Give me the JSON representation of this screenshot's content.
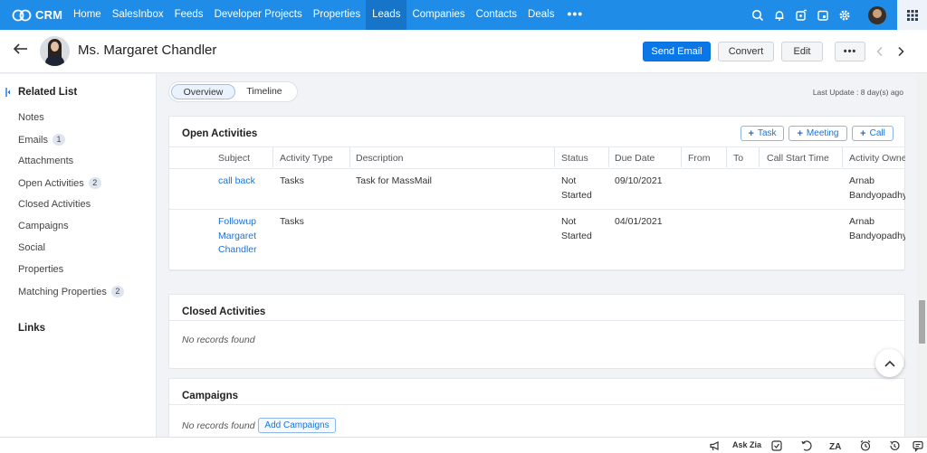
{
  "app": {
    "name": "CRM"
  },
  "nav": {
    "items": [
      "Home",
      "SalesInbox",
      "Feeds",
      "Developer Projects",
      "Properties",
      "Leads",
      "Companies",
      "Contacts",
      "Deals"
    ],
    "active": "Leads",
    "more": "•••",
    "icons": [
      "search-icon",
      "bell-icon",
      "compose-icon",
      "calendar-icon",
      "gear-icon",
      "user-avatar",
      "apps-grid-icon"
    ]
  },
  "record": {
    "name": "Ms. Margaret Chandler",
    "buttons": {
      "send_email": "Send Email",
      "convert": "Convert",
      "edit": "Edit",
      "more": "•••"
    }
  },
  "sidebar": {
    "title": "Related List",
    "items": [
      {
        "label": "Notes",
        "count": ""
      },
      {
        "label": "Emails",
        "count": "1"
      },
      {
        "label": "Attachments",
        "count": ""
      },
      {
        "label": "Open Activities",
        "count": "2"
      },
      {
        "label": "Closed Activities",
        "count": ""
      },
      {
        "label": "Campaigns",
        "count": ""
      },
      {
        "label": "Social",
        "count": ""
      },
      {
        "label": "Properties",
        "count": ""
      },
      {
        "label": "Matching Properties",
        "count": "2"
      }
    ],
    "links": "Links"
  },
  "tabs": {
    "overview": "Overview",
    "timeline": "Timeline"
  },
  "last_update": "Last Update : 8 day(s) ago",
  "open_activities": {
    "title": "Open Activities",
    "buttons": {
      "task": "Task",
      "meeting": "Meeting",
      "call": "Call"
    },
    "columns": [
      "Subject",
      "Activity Type",
      "Description",
      "Status",
      "Due Date",
      "From",
      "To",
      "Call Start Time",
      "Activity Owne"
    ],
    "rows": [
      {
        "subject": [
          "call back"
        ],
        "type": "Tasks",
        "description": "Task for MassMail",
        "status": [
          "Not",
          "Started"
        ],
        "due": "09/10/2021",
        "owner": [
          "Arnab",
          "Bandyopadhya"
        ]
      },
      {
        "subject": [
          "Followup",
          "Margaret",
          "Chandler"
        ],
        "type": "Tasks",
        "description": "",
        "status": [
          "Not",
          "Started"
        ],
        "due": "04/01/2021",
        "owner": [
          "Arnab",
          "Bandyopadhya"
        ]
      }
    ]
  },
  "closed_activities": {
    "title": "Closed Activities",
    "empty": "No records found"
  },
  "campaigns": {
    "title": "Campaigns",
    "empty": "No records found",
    "add": "Add Campaigns"
  },
  "bottom_bar": {
    "ask_zia": "Ask Zia"
  },
  "colors": {
    "nav": "#1f8ce8",
    "nav_active": "#1775c9",
    "primary": "#0a77e8",
    "link": "#1a73d8"
  }
}
